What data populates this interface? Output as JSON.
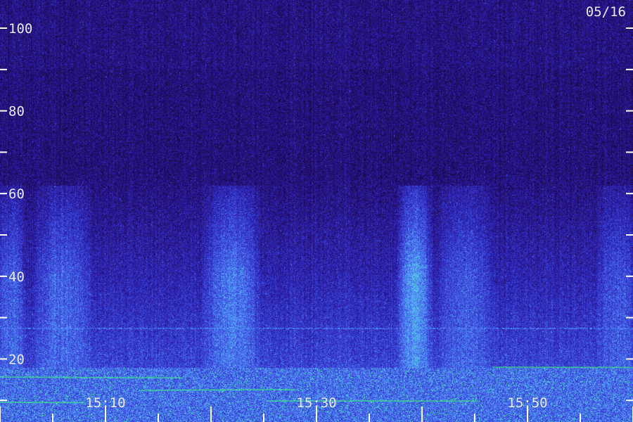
{
  "date_label": "05/16",
  "chart_data": {
    "type": "heatmap",
    "title": "",
    "xlabel": "",
    "ylabel": "",
    "ylim": [
      0,
      100
    ],
    "y_ticks": [
      20,
      40,
      60,
      80,
      100
    ],
    "y_minor_ticks": [
      10,
      30,
      50,
      70,
      90
    ],
    "x_ticks": [
      {
        "label": "15:10",
        "minute": 10
      },
      {
        "label": "15:30",
        "minute": 30
      },
      {
        "label": "15:50",
        "minute": 50
      }
    ],
    "x_range_minutes": [
      0,
      60
    ],
    "colors": {
      "background": "#1a0a4a",
      "low": "#1c0c50",
      "mid": "#3a3ad0",
      "high": "#5aa0ff",
      "peak": "#40ff80",
      "text": "#e8e8ff"
    },
    "bursts": [
      {
        "start_minute": 0,
        "end_minute": 2,
        "intensity": 0.55
      },
      {
        "start_minute": 4,
        "end_minute": 8,
        "intensity": 0.6
      },
      {
        "start_minute": 20,
        "end_minute": 24,
        "intensity": 0.75
      },
      {
        "start_minute": 38,
        "end_minute": 40.5,
        "intensity": 1.0
      },
      {
        "start_minute": 42,
        "end_minute": 46,
        "intensity": 0.5
      },
      {
        "start_minute": 57,
        "end_minute": 60,
        "intensity": 0.45
      }
    ]
  }
}
